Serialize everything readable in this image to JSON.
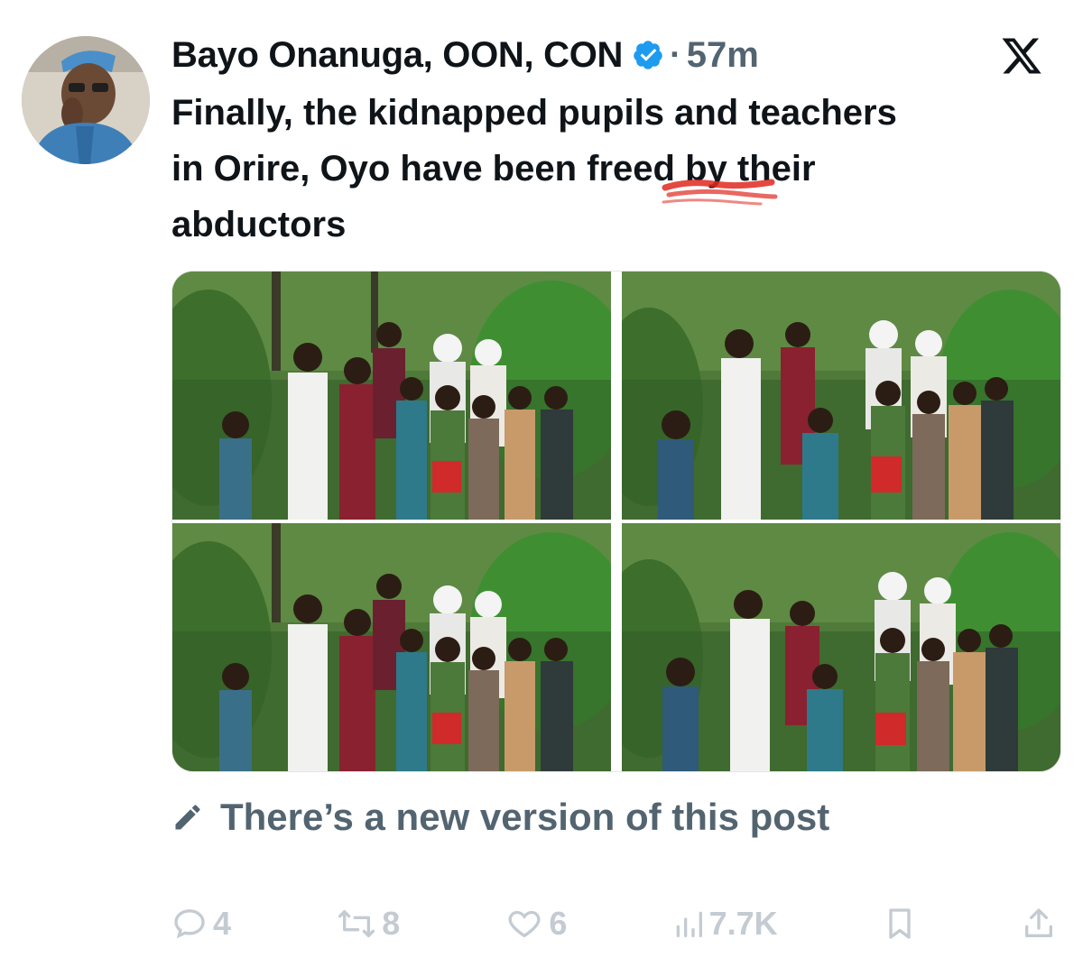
{
  "post": {
    "author_name": "Bayo Onanuga, OON, CON",
    "separator": "·",
    "time": "57m",
    "text": "Finally, the kidnapped pupils and teachers\nin Orire, Oyo have been freed by their\nabductors"
  },
  "edit_notice": "There’s a new version of this post",
  "actions": {
    "replies": "4",
    "reposts": "8",
    "likes": "6",
    "views": "7.7K"
  },
  "icons": {
    "verified": "verified-badge-icon",
    "logo": "x-logo-icon",
    "edit": "pencil-icon",
    "reply": "reply-icon",
    "repost": "repost-icon",
    "like": "heart-icon",
    "views": "views-icon",
    "bookmark": "bookmark-icon",
    "share": "share-icon"
  },
  "colors": {
    "verified": "#1d9bf0",
    "secondary_text": "#536471",
    "action_icons": "#c4cbd2",
    "underline_mark": "#e0281e"
  }
}
